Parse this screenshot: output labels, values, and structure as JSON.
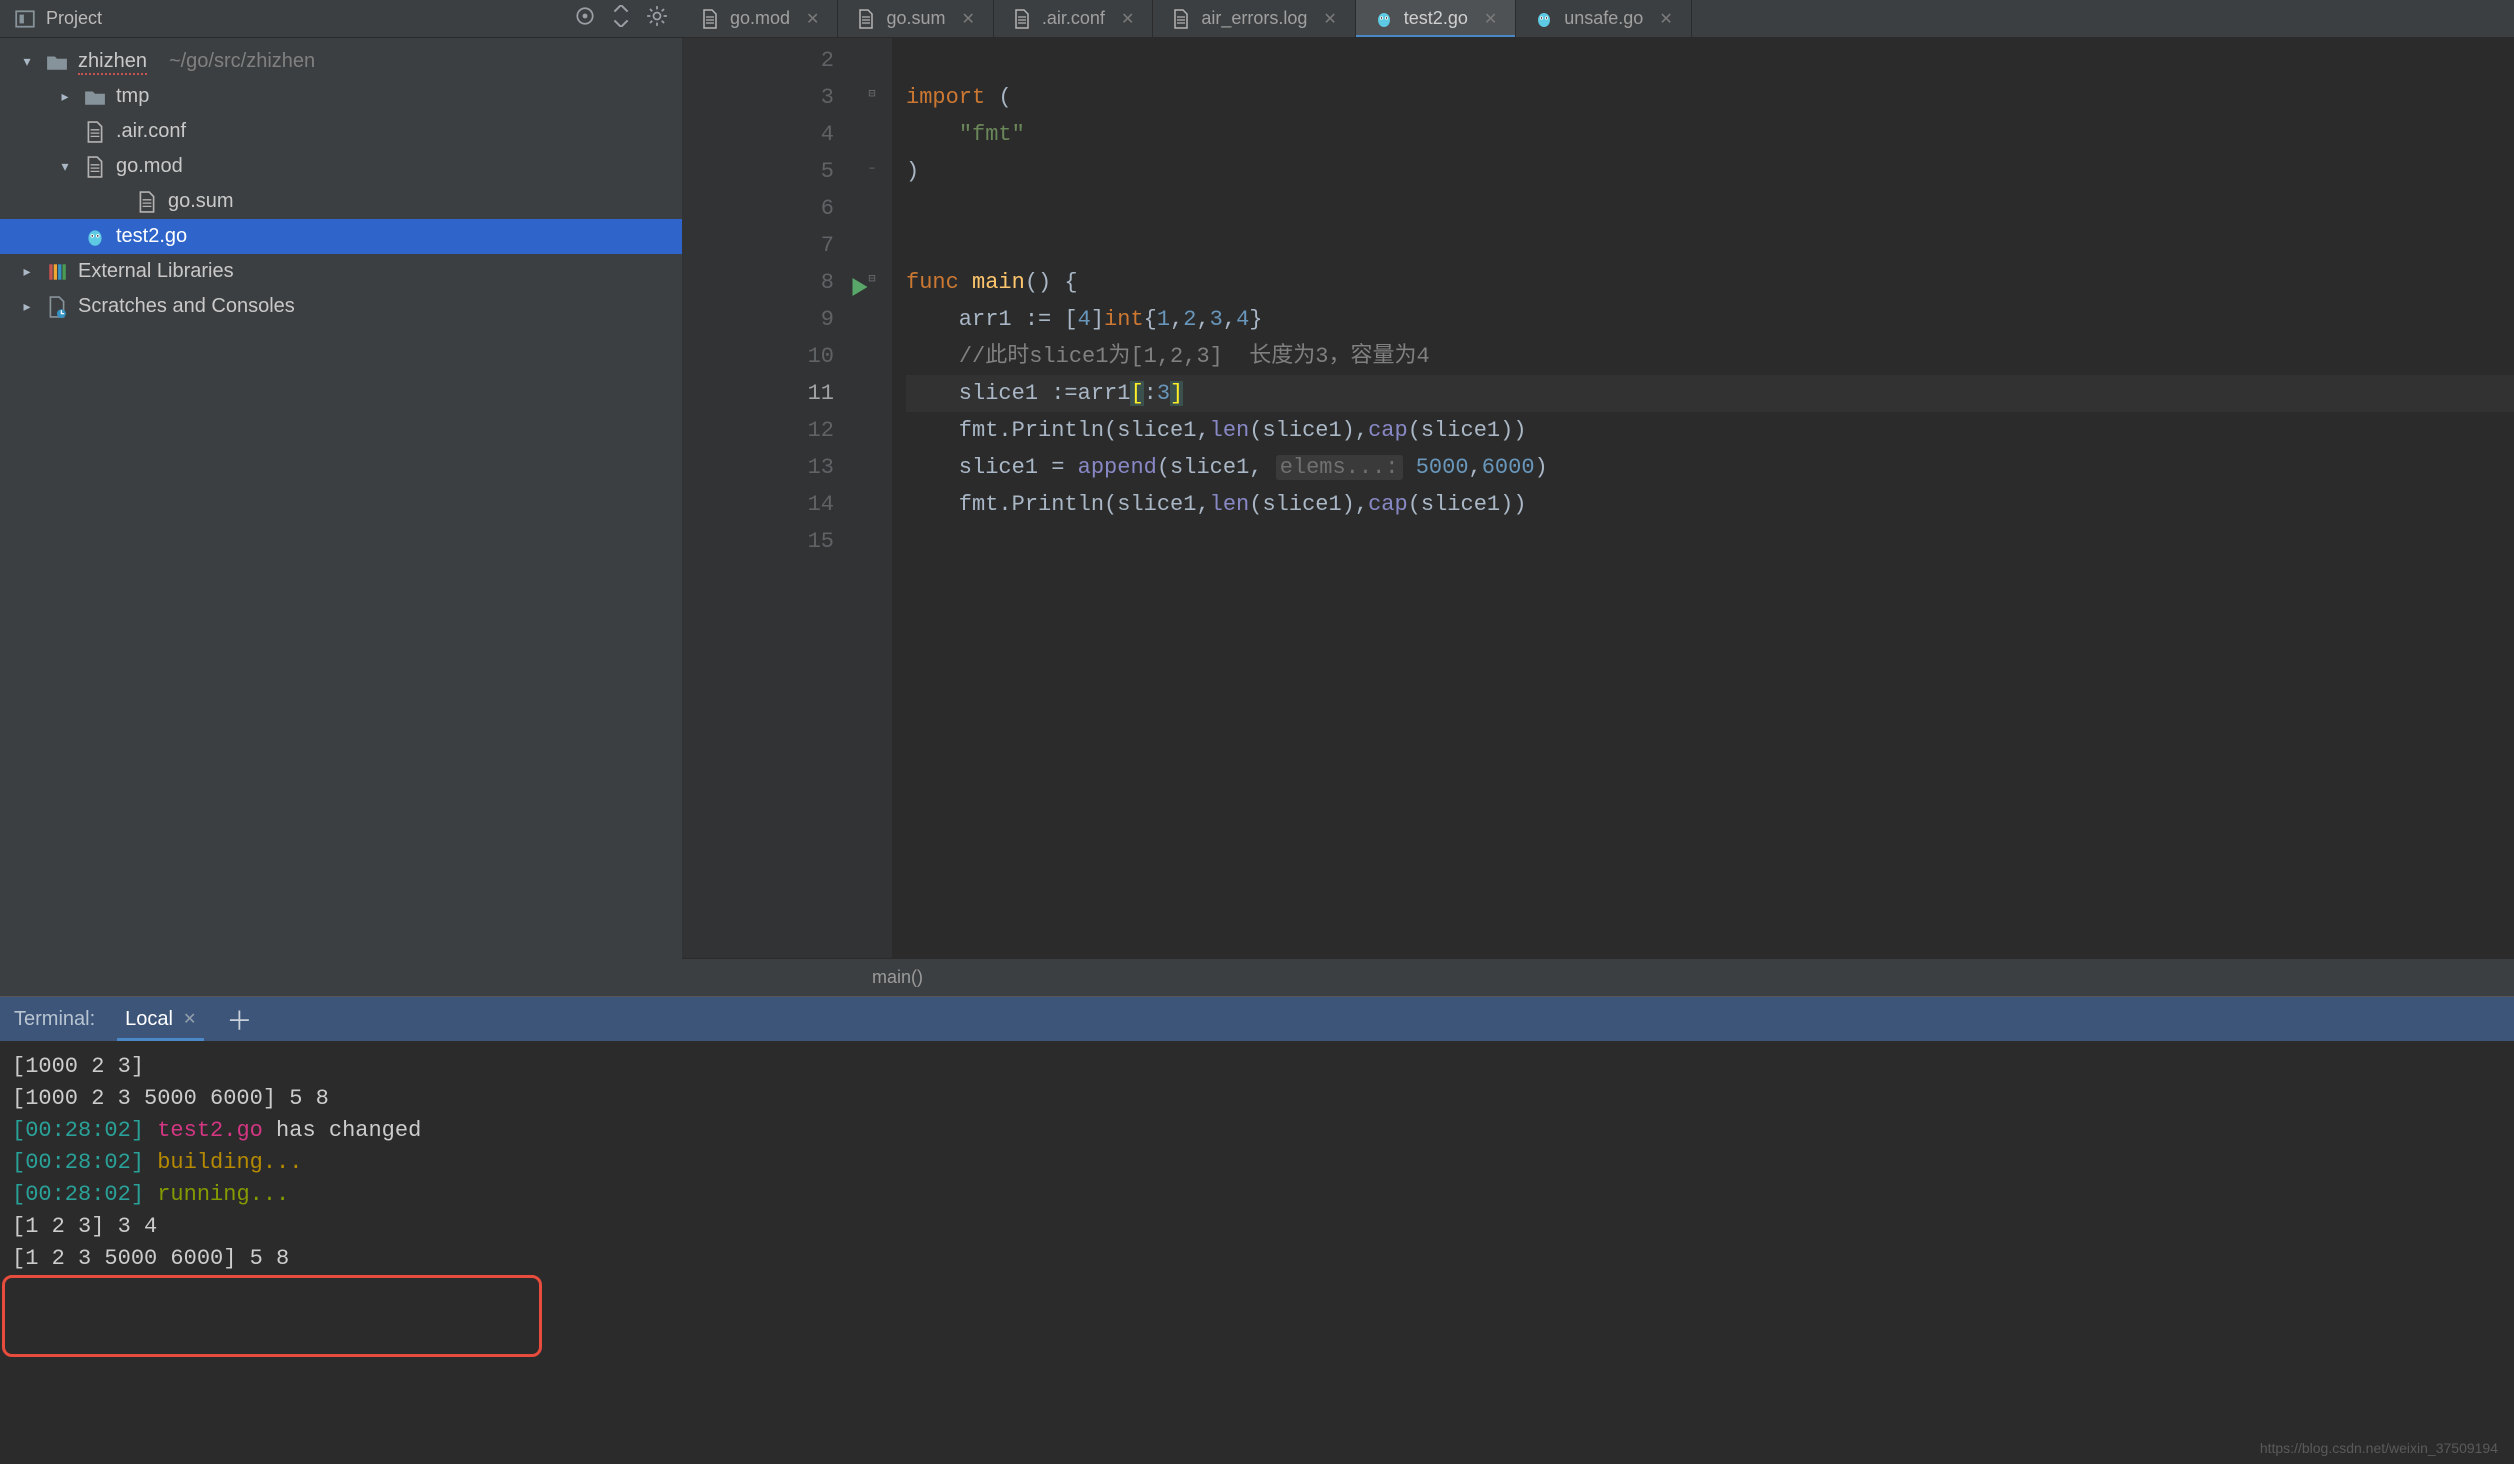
{
  "toolbar": {
    "project_label": "Project"
  },
  "tabs": [
    {
      "label": "go.mod",
      "icon": "file",
      "active": false
    },
    {
      "label": "go.sum",
      "icon": "file",
      "active": false
    },
    {
      "label": ".air.conf",
      "icon": "file",
      "active": false
    },
    {
      "label": "air_errors.log",
      "icon": "file",
      "active": false
    },
    {
      "label": "test2.go",
      "icon": "gopher",
      "active": true
    },
    {
      "label": "unsafe.go",
      "icon": "gopher",
      "active": false
    }
  ],
  "project_tree": {
    "root_name": "zhizhen",
    "root_path": "~/go/src/zhizhen",
    "items": [
      {
        "depth": 0,
        "icon": "folder",
        "caret": "down",
        "label": "zhizhen",
        "suffix": "~/go/src/zhizhen",
        "squiggle": true
      },
      {
        "depth": 1,
        "icon": "folder",
        "caret": "right",
        "label": "tmp"
      },
      {
        "depth": 1,
        "icon": "file",
        "caret": "none",
        "label": ".air.conf"
      },
      {
        "depth": 1,
        "icon": "file",
        "caret": "down",
        "label": "go.mod"
      },
      {
        "depth": 2,
        "icon": "file",
        "caret": "none",
        "label": "go.sum"
      },
      {
        "depth": 1,
        "icon": "gopher",
        "caret": "none",
        "label": "test2.go",
        "selected": true
      },
      {
        "depth": 0,
        "icon": "libs",
        "caret": "right",
        "label": "External Libraries"
      },
      {
        "depth": 0,
        "icon": "scratch",
        "caret": "right",
        "label": "Scratches and Consoles"
      }
    ]
  },
  "editor": {
    "breadcrumb": "main()",
    "current_line": 11,
    "lines": [
      {
        "n": 2,
        "tokens": []
      },
      {
        "n": 3,
        "tokens": [
          [
            "kw",
            "import"
          ],
          [
            "def",
            " ("
          ]
        ]
      },
      {
        "n": 4,
        "tokens": [
          [
            "def",
            "    "
          ],
          [
            "str",
            "\"fmt\""
          ]
        ]
      },
      {
        "n": 5,
        "tokens": [
          [
            "def",
            ")"
          ]
        ]
      },
      {
        "n": 6,
        "tokens": []
      },
      {
        "n": 7,
        "tokens": []
      },
      {
        "n": 8,
        "run": true,
        "tokens": [
          [
            "kw",
            "func"
          ],
          [
            "def",
            " "
          ],
          [
            "fn",
            "main"
          ],
          [
            "def",
            "() {"
          ]
        ]
      },
      {
        "n": 9,
        "tokens": [
          [
            "def",
            "    arr1 := ["
          ],
          [
            "num",
            "4"
          ],
          [
            "def",
            "]"
          ],
          [
            "kw",
            "int"
          ],
          [
            "def",
            "{"
          ],
          [
            "num",
            "1"
          ],
          [
            "def",
            ","
          ],
          [
            "num",
            "2"
          ],
          [
            "def",
            ","
          ],
          [
            "num",
            "3"
          ],
          [
            "def",
            ","
          ],
          [
            "num",
            "4"
          ],
          [
            "def",
            "}"
          ]
        ]
      },
      {
        "n": 10,
        "tokens": [
          [
            "def",
            "    "
          ],
          [
            "cmt",
            "//此时slice1为[1,2,3]  长度为3，容量为4"
          ]
        ]
      },
      {
        "n": 11,
        "tokens": [
          [
            "def",
            "    slice1 :=arr1"
          ],
          [
            "hlb",
            "["
          ],
          [
            "def",
            ":"
          ],
          [
            "num",
            "3"
          ],
          [
            "hlb",
            "]"
          ]
        ]
      },
      {
        "n": 12,
        "tokens": [
          [
            "def",
            "    fmt.Println(slice1,"
          ],
          [
            "builtin",
            "len"
          ],
          [
            "def",
            "(slice1),"
          ],
          [
            "builtin",
            "cap"
          ],
          [
            "def",
            "(slice1))"
          ]
        ]
      },
      {
        "n": 13,
        "tokens": [
          [
            "def",
            "    slice1 = "
          ],
          [
            "builtin",
            "append"
          ],
          [
            "def",
            "(slice1, "
          ],
          [
            "pale",
            "elems...:"
          ],
          [
            "def",
            " "
          ],
          [
            "num",
            "5000"
          ],
          [
            "def",
            ","
          ],
          [
            "num",
            "6000"
          ],
          [
            "def",
            ")"
          ]
        ]
      },
      {
        "n": 14,
        "tokens": [
          [
            "def",
            "    fmt.Println(slice1,"
          ],
          [
            "builtin",
            "len"
          ],
          [
            "def",
            "(slice1),"
          ],
          [
            "builtin",
            "cap"
          ],
          [
            "def",
            "(slice1))"
          ]
        ]
      },
      {
        "n": 15,
        "tokens": []
      }
    ]
  },
  "terminal": {
    "panel_label": "Terminal:",
    "tab_label": "Local",
    "lines": [
      [
        [
          "def",
          "[1000 2 3]"
        ]
      ],
      [
        [
          "def",
          "[1000 2 3 5000 6000] 5 8"
        ]
      ],
      [
        [
          "cyan",
          "[00:28:02] "
        ],
        [
          "mag",
          "test2.go"
        ],
        [
          "def",
          " has changed"
        ]
      ],
      [
        [
          "cyan",
          "[00:28:02] "
        ],
        [
          "yel",
          "building..."
        ]
      ],
      [
        [
          "cyan",
          "[00:28:02] "
        ],
        [
          "grn",
          "running..."
        ]
      ],
      [
        [
          "def",
          "[1 2 3] 3 4"
        ]
      ],
      [
        [
          "def",
          "[1 2 3 5000 6000] 5 8"
        ]
      ]
    ]
  },
  "watermark": "https://blog.csdn.net/weixin_37509194"
}
